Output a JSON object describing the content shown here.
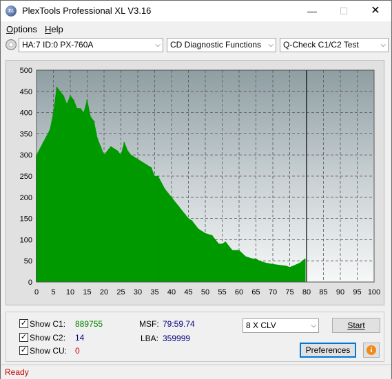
{
  "window": {
    "title": "PlexTools Professional XL V3.16",
    "icon_text": "XL"
  },
  "menu": [
    {
      "label": "Options",
      "underline": "O",
      "rest": "ptions"
    },
    {
      "label": "Help",
      "underline": "H",
      "rest": "elp"
    }
  ],
  "toolbar": {
    "drive": "HA:7 ID:0  PX-760A",
    "function": "CD Diagnostic Functions",
    "test": "Q-Check C1/C2 Test"
  },
  "chart_data": {
    "type": "bar",
    "title": "",
    "xlabel": "",
    "ylabel": "",
    "xlim": [
      0,
      100
    ],
    "ylim": [
      0,
      500
    ],
    "x_ticks": [
      0,
      5,
      10,
      15,
      20,
      25,
      30,
      35,
      40,
      45,
      50,
      55,
      60,
      65,
      70,
      75,
      80,
      85,
      90,
      95,
      100
    ],
    "y_ticks": [
      0,
      50,
      100,
      150,
      200,
      250,
      300,
      350,
      400,
      450,
      500
    ],
    "grid": true,
    "marker_x": 80,
    "series": [
      {
        "color": "#009900",
        "x": [
          0,
          2,
          4,
          5,
          6,
          7,
          8,
          9,
          10,
          11,
          12,
          13,
          14,
          15,
          16,
          17,
          18,
          19,
          20,
          22,
          24,
          25,
          26,
          27,
          28,
          30,
          32,
          34,
          35,
          36,
          38,
          40,
          42,
          44,
          45,
          46,
          48,
          50,
          52,
          54,
          55,
          56,
          58,
          60,
          62,
          64,
          65,
          66,
          68,
          70,
          72,
          74,
          75,
          76,
          78,
          79.5
        ],
        "values": [
          300,
          330,
          360,
          400,
          460,
          450,
          440,
          420,
          440,
          430,
          410,
          410,
          400,
          430,
          390,
          380,
          340,
          320,
          300,
          320,
          310,
          300,
          330,
          310,
          300,
          290,
          280,
          270,
          250,
          250,
          220,
          200,
          180,
          160,
          150,
          145,
          125,
          115,
          110,
          90,
          90,
          95,
          75,
          75,
          60,
          55,
          55,
          50,
          45,
          42,
          40,
          38,
          35,
          38,
          45,
          55
        ]
      }
    ]
  },
  "bottom": {
    "show_c1_label": "Show C1:",
    "c1_value": "889755",
    "c1_color": "#008000",
    "show_c2_label": "Show C2:",
    "c2_value": "14",
    "c2_color": "#000080",
    "show_cu_label": "Show CU:",
    "cu_value": "0",
    "cu_color": "#cc0000",
    "msf_label": "MSF:",
    "msf_value": "79:59.74",
    "lba_label": "LBA:",
    "lba_value": "359999",
    "speed": "8 X CLV",
    "start_button": "Start",
    "preferences_button": "Preferences",
    "info_icon": "info-icon"
  },
  "status": "Ready"
}
